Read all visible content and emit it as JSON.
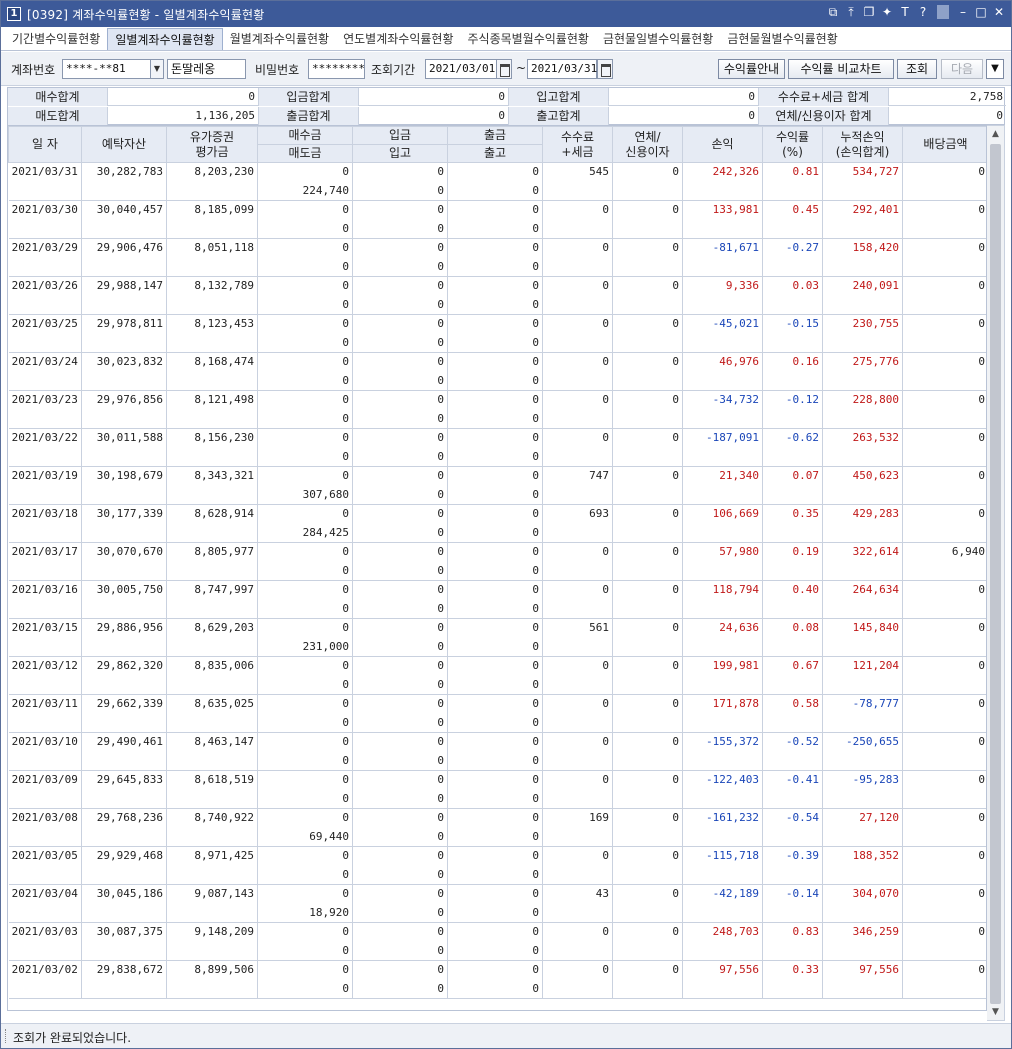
{
  "window": {
    "number": "1",
    "title": "[0392] 계좌수익률현황 - 일별계좌수익률현황",
    "icons": [
      "restore-window-icon",
      "pin-up-icon",
      "tile-icon",
      "pin-icon",
      "font-icon",
      "help-icon",
      "minimize-icon",
      "maximize-icon",
      "close-icon"
    ]
  },
  "tabs": [
    "기간별수익률현황",
    "일별계좌수익률현황",
    "월별계좌수익률현황",
    "연도별계좌수익률현황",
    "주식종목별월수익률현황",
    "금현물일별수익률현황",
    "금현물월별수익률현황"
  ],
  "active_tab_index": 1,
  "toolbar": {
    "account_label": "계좌번호",
    "account_value": "****-**81",
    "account_name": "돈딸레옹",
    "password_label": "비밀번호",
    "password_value": "********",
    "period_label": "조회기간",
    "start_date": "2021/03/01",
    "tilde": "~",
    "end_date": "2021/03/31",
    "btn_guide": "수익률안내",
    "btn_compare": "수익률 비교차트",
    "btn_search": "조회",
    "btn_next": "다음",
    "btn_arrow": "▼"
  },
  "summary": {
    "buy_total_label": "매수합계",
    "buy_total": "0",
    "deposit_total_label": "입금합계",
    "deposit_total": "0",
    "stock_in_total_label": "입고합계",
    "stock_in_total": "0",
    "fee_tax_total_label": "수수료+세금 합계",
    "fee_tax_total": "2,758",
    "sell_total_label": "매도합계",
    "sell_total": "1,136,205",
    "withdraw_total_label": "출금합계",
    "withdraw_total": "0",
    "stock_out_total_label": "출고합계",
    "stock_out_total": "0",
    "overdue_total_label": "연체/신용이자 합계",
    "overdue_total": "0"
  },
  "columns": {
    "date": "일 자",
    "deposit_assets": "예탁자산",
    "securities_l1": "유가증권",
    "securities_l2": "평가금",
    "buy": "매수금",
    "sell": "매도금",
    "deposit": "입금",
    "stock_in": "입고",
    "withdraw": "출금",
    "stock_out": "출고",
    "fee_l1": "수수료",
    "fee_l2": "+세금",
    "overdue_l1": "연체/",
    "overdue_l2": "신용이자",
    "pnl": "손익",
    "rate_l1": "수익률",
    "rate_l2": "(%)",
    "cum_l1": "누적손익",
    "cum_l2": "(손익합계)",
    "dividend": "배당금액"
  },
  "rows": [
    {
      "date": "2021/03/31",
      "assets": "30,282,783",
      "securities": "8,203,230",
      "buy": "0",
      "sell": "224,740",
      "deposit": "0",
      "stock_in": "0",
      "withdraw": "0",
      "stock_out": "0",
      "fee": "545",
      "overdue": "0",
      "pnl": "242,326",
      "rate": "0.81",
      "cum": "534,727",
      "dividend": "0",
      "pnl_sign": "pos",
      "cum_sign": "pos"
    },
    {
      "date": "2021/03/30",
      "assets": "30,040,457",
      "securities": "8,185,099",
      "buy": "0",
      "sell": "0",
      "deposit": "0",
      "stock_in": "0",
      "withdraw": "0",
      "stock_out": "0",
      "fee": "0",
      "overdue": "0",
      "pnl": "133,981",
      "rate": "0.45",
      "cum": "292,401",
      "dividend": "0",
      "pnl_sign": "pos",
      "cum_sign": "pos"
    },
    {
      "date": "2021/03/29",
      "assets": "29,906,476",
      "securities": "8,051,118",
      "buy": "0",
      "sell": "0",
      "deposit": "0",
      "stock_in": "0",
      "withdraw": "0",
      "stock_out": "0",
      "fee": "0",
      "overdue": "0",
      "pnl": "-81,671",
      "rate": "-0.27",
      "cum": "158,420",
      "dividend": "0",
      "pnl_sign": "neg",
      "cum_sign": "pos"
    },
    {
      "date": "2021/03/26",
      "assets": "29,988,147",
      "securities": "8,132,789",
      "buy": "0",
      "sell": "0",
      "deposit": "0",
      "stock_in": "0",
      "withdraw": "0",
      "stock_out": "0",
      "fee": "0",
      "overdue": "0",
      "pnl": "9,336",
      "rate": "0.03",
      "cum": "240,091",
      "dividend": "0",
      "pnl_sign": "pos",
      "cum_sign": "pos"
    },
    {
      "date": "2021/03/25",
      "assets": "29,978,811",
      "securities": "8,123,453",
      "buy": "0",
      "sell": "0",
      "deposit": "0",
      "stock_in": "0",
      "withdraw": "0",
      "stock_out": "0",
      "fee": "0",
      "overdue": "0",
      "pnl": "-45,021",
      "rate": "-0.15",
      "cum": "230,755",
      "dividend": "0",
      "pnl_sign": "neg",
      "cum_sign": "pos"
    },
    {
      "date": "2021/03/24",
      "assets": "30,023,832",
      "securities": "8,168,474",
      "buy": "0",
      "sell": "0",
      "deposit": "0",
      "stock_in": "0",
      "withdraw": "0",
      "stock_out": "0",
      "fee": "0",
      "overdue": "0",
      "pnl": "46,976",
      "rate": "0.16",
      "cum": "275,776",
      "dividend": "0",
      "pnl_sign": "pos",
      "cum_sign": "pos"
    },
    {
      "date": "2021/03/23",
      "assets": "29,976,856",
      "securities": "8,121,498",
      "buy": "0",
      "sell": "0",
      "deposit": "0",
      "stock_in": "0",
      "withdraw": "0",
      "stock_out": "0",
      "fee": "0",
      "overdue": "0",
      "pnl": "-34,732",
      "rate": "-0.12",
      "cum": "228,800",
      "dividend": "0",
      "pnl_sign": "neg",
      "cum_sign": "pos"
    },
    {
      "date": "2021/03/22",
      "assets": "30,011,588",
      "securities": "8,156,230",
      "buy": "0",
      "sell": "0",
      "deposit": "0",
      "stock_in": "0",
      "withdraw": "0",
      "stock_out": "0",
      "fee": "0",
      "overdue": "0",
      "pnl": "-187,091",
      "rate": "-0.62",
      "cum": "263,532",
      "dividend": "0",
      "pnl_sign": "neg",
      "cum_sign": "pos"
    },
    {
      "date": "2021/03/19",
      "assets": "30,198,679",
      "securities": "8,343,321",
      "buy": "0",
      "sell": "307,680",
      "deposit": "0",
      "stock_in": "0",
      "withdraw": "0",
      "stock_out": "0",
      "fee": "747",
      "overdue": "0",
      "pnl": "21,340",
      "rate": "0.07",
      "cum": "450,623",
      "dividend": "0",
      "pnl_sign": "pos",
      "cum_sign": "pos"
    },
    {
      "date": "2021/03/18",
      "assets": "30,177,339",
      "securities": "8,628,914",
      "buy": "0",
      "sell": "284,425",
      "deposit": "0",
      "stock_in": "0",
      "withdraw": "0",
      "stock_out": "0",
      "fee": "693",
      "overdue": "0",
      "pnl": "106,669",
      "rate": "0.35",
      "cum": "429,283",
      "dividend": "0",
      "pnl_sign": "pos",
      "cum_sign": "pos"
    },
    {
      "date": "2021/03/17",
      "assets": "30,070,670",
      "securities": "8,805,977",
      "buy": "0",
      "sell": "0",
      "deposit": "0",
      "stock_in": "0",
      "withdraw": "0",
      "stock_out": "0",
      "fee": "0",
      "overdue": "0",
      "pnl": "57,980",
      "rate": "0.19",
      "cum": "322,614",
      "dividend": "6,940",
      "pnl_sign": "pos",
      "cum_sign": "pos"
    },
    {
      "date": "2021/03/16",
      "assets": "30,005,750",
      "securities": "8,747,997",
      "buy": "0",
      "sell": "0",
      "deposit": "0",
      "stock_in": "0",
      "withdraw": "0",
      "stock_out": "0",
      "fee": "0",
      "overdue": "0",
      "pnl": "118,794",
      "rate": "0.40",
      "cum": "264,634",
      "dividend": "0",
      "pnl_sign": "pos",
      "cum_sign": "pos"
    },
    {
      "date": "2021/03/15",
      "assets": "29,886,956",
      "securities": "8,629,203",
      "buy": "0",
      "sell": "231,000",
      "deposit": "0",
      "stock_in": "0",
      "withdraw": "0",
      "stock_out": "0",
      "fee": "561",
      "overdue": "0",
      "pnl": "24,636",
      "rate": "0.08",
      "cum": "145,840",
      "dividend": "0",
      "pnl_sign": "pos",
      "cum_sign": "pos"
    },
    {
      "date": "2021/03/12",
      "assets": "29,862,320",
      "securities": "8,835,006",
      "buy": "0",
      "sell": "0",
      "deposit": "0",
      "stock_in": "0",
      "withdraw": "0",
      "stock_out": "0",
      "fee": "0",
      "overdue": "0",
      "pnl": "199,981",
      "rate": "0.67",
      "cum": "121,204",
      "dividend": "0",
      "pnl_sign": "pos",
      "cum_sign": "pos"
    },
    {
      "date": "2021/03/11",
      "assets": "29,662,339",
      "securities": "8,635,025",
      "buy": "0",
      "sell": "0",
      "deposit": "0",
      "stock_in": "0",
      "withdraw": "0",
      "stock_out": "0",
      "fee": "0",
      "overdue": "0",
      "pnl": "171,878",
      "rate": "0.58",
      "cum": "-78,777",
      "dividend": "0",
      "pnl_sign": "pos",
      "cum_sign": "neg"
    },
    {
      "date": "2021/03/10",
      "assets": "29,490,461",
      "securities": "8,463,147",
      "buy": "0",
      "sell": "0",
      "deposit": "0",
      "stock_in": "0",
      "withdraw": "0",
      "stock_out": "0",
      "fee": "0",
      "overdue": "0",
      "pnl": "-155,372",
      "rate": "-0.52",
      "cum": "-250,655",
      "dividend": "0",
      "pnl_sign": "neg",
      "cum_sign": "neg"
    },
    {
      "date": "2021/03/09",
      "assets": "29,645,833",
      "securities": "8,618,519",
      "buy": "0",
      "sell": "0",
      "deposit": "0",
      "stock_in": "0",
      "withdraw": "0",
      "stock_out": "0",
      "fee": "0",
      "overdue": "0",
      "pnl": "-122,403",
      "rate": "-0.41",
      "cum": "-95,283",
      "dividend": "0",
      "pnl_sign": "neg",
      "cum_sign": "neg"
    },
    {
      "date": "2021/03/08",
      "assets": "29,768,236",
      "securities": "8,740,922",
      "buy": "0",
      "sell": "69,440",
      "deposit": "0",
      "stock_in": "0",
      "withdraw": "0",
      "stock_out": "0",
      "fee": "169",
      "overdue": "0",
      "pnl": "-161,232",
      "rate": "-0.54",
      "cum": "27,120",
      "dividend": "0",
      "pnl_sign": "neg",
      "cum_sign": "pos"
    },
    {
      "date": "2021/03/05",
      "assets": "29,929,468",
      "securities": "8,971,425",
      "buy": "0",
      "sell": "0",
      "deposit": "0",
      "stock_in": "0",
      "withdraw": "0",
      "stock_out": "0",
      "fee": "0",
      "overdue": "0",
      "pnl": "-115,718",
      "rate": "-0.39",
      "cum": "188,352",
      "dividend": "0",
      "pnl_sign": "neg",
      "cum_sign": "pos"
    },
    {
      "date": "2021/03/04",
      "assets": "30,045,186",
      "securities": "9,087,143",
      "buy": "0",
      "sell": "18,920",
      "deposit": "0",
      "stock_in": "0",
      "withdraw": "0",
      "stock_out": "0",
      "fee": "43",
      "overdue": "0",
      "pnl": "-42,189",
      "rate": "-0.14",
      "cum": "304,070",
      "dividend": "0",
      "pnl_sign": "neg",
      "cum_sign": "pos"
    },
    {
      "date": "2021/03/03",
      "assets": "30,087,375",
      "securities": "9,148,209",
      "buy": "0",
      "sell": "0",
      "deposit": "0",
      "stock_in": "0",
      "withdraw": "0",
      "stock_out": "0",
      "fee": "0",
      "overdue": "0",
      "pnl": "248,703",
      "rate": "0.83",
      "cum": "346,259",
      "dividend": "0",
      "pnl_sign": "pos",
      "cum_sign": "pos"
    },
    {
      "date": "2021/03/02",
      "assets": "29,838,672",
      "securities": "8,899,506",
      "buy": "0",
      "sell": "0",
      "deposit": "0",
      "stock_in": "0",
      "withdraw": "0",
      "stock_out": "0",
      "fee": "0",
      "overdue": "0",
      "pnl": "97,556",
      "rate": "0.33",
      "cum": "97,556",
      "dividend": "0",
      "pnl_sign": "pos",
      "cum_sign": "pos"
    }
  ],
  "colors": {
    "positive": "#c01818",
    "negative": "#1a46b8",
    "title_bar": "#3d5a99"
  },
  "status": "조회가 완료되었습니다."
}
